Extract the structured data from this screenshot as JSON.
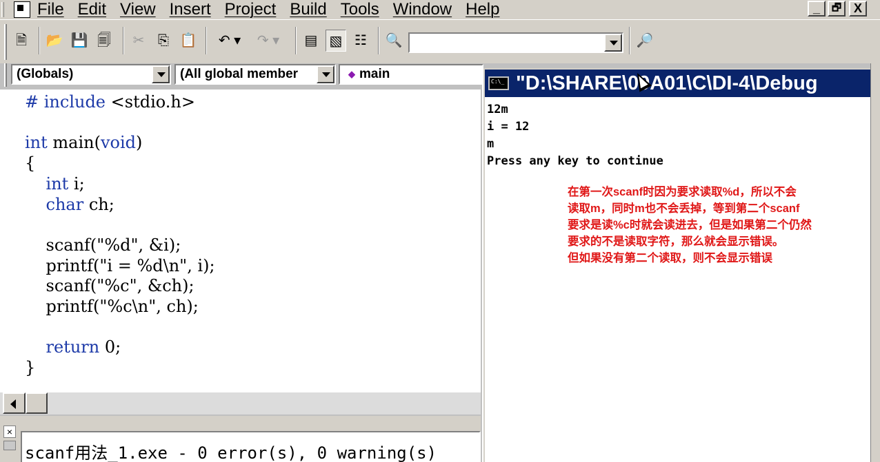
{
  "menubar": {
    "items": [
      "File",
      "Edit",
      "View",
      "Insert",
      "Project",
      "Build",
      "Tools",
      "Window",
      "Help"
    ],
    "window_buttons": [
      "_",
      "🗗",
      "X"
    ]
  },
  "toolbar": {
    "find_combo_value": ""
  },
  "wizardbar": {
    "scope": "(Globals)",
    "members": "(All global member",
    "function": "main",
    "function_icon": "diamond-icon"
  },
  "editor": {
    "lines": [
      [
        {
          "t": "# include ",
          "c": "kw"
        },
        {
          "t": "<stdio.h>",
          "c": ""
        }
      ],
      [],
      [
        {
          "t": "int",
          "c": "kw"
        },
        {
          "t": " main(",
          "c": ""
        },
        {
          "t": "void",
          "c": "kw"
        },
        {
          "t": ")",
          "c": ""
        }
      ],
      [
        {
          "t": "{",
          "c": ""
        }
      ],
      [
        {
          "t": "    ",
          "c": ""
        },
        {
          "t": "int",
          "c": "kw"
        },
        {
          "t": " i;",
          "c": ""
        }
      ],
      [
        {
          "t": "    ",
          "c": ""
        },
        {
          "t": "char",
          "c": "kw"
        },
        {
          "t": " ch;",
          "c": ""
        }
      ],
      [],
      [
        {
          "t": "    scanf(\"%d\", &i);",
          "c": ""
        }
      ],
      [
        {
          "t": "    printf(\"i = %d\\n\", i);",
          "c": ""
        }
      ],
      [
        {
          "t": "    scanf(\"%c\", &ch);",
          "c": ""
        }
      ],
      [
        {
          "t": "    printf(\"%c\\n\", ch);",
          "c": ""
        }
      ],
      [],
      [
        {
          "t": "    ",
          "c": ""
        },
        {
          "t": "return",
          "c": "kw"
        },
        {
          "t": " 0;",
          "c": ""
        }
      ],
      [
        {
          "t": "}",
          "c": ""
        }
      ]
    ]
  },
  "output": {
    "text": "scanf用法_1.exe - 0 error(s), 0 warning(s)"
  },
  "console": {
    "title": "\"D:\\SHARE\\09A01\\C\\DI-4\\Debug",
    "lines": [
      "12m",
      "i = 12",
      "m",
      "Press any key to continue"
    ],
    "annotation": [
      "在第一次scanf时因为要求读取%d，所以不会",
      "读取m，同时m也不会丢掉，等到第二个scanf",
      "要求是读%c时就会读进去，但是如果第二个仍然",
      "要求的不是读取字符，那么就会显示错误。",
      "但如果没有第二个读取，则不会显示错误"
    ]
  },
  "colors": {
    "keyword": "#1d3aa8",
    "annotation": "#e01818",
    "console_title_bg": "#0a246a",
    "chrome": "#d4d0c8"
  }
}
